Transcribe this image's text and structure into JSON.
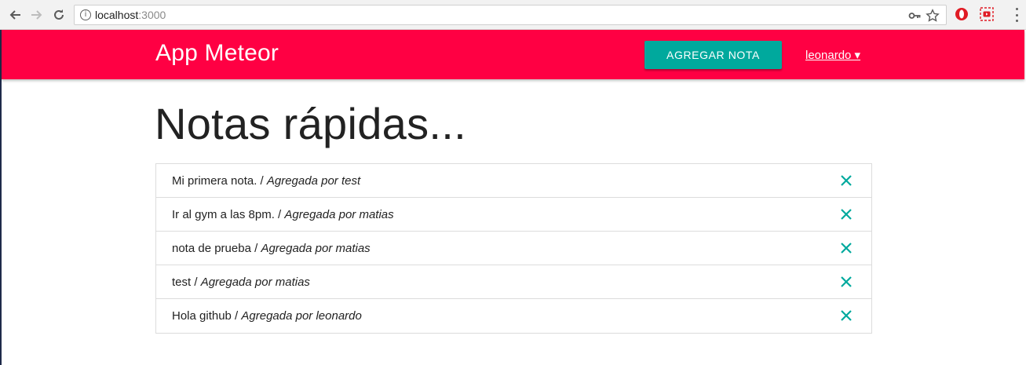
{
  "browser": {
    "address_host": "localhost",
    "address_port": ":3000"
  },
  "header": {
    "app_title": "App Meteor",
    "add_note_label": "AGREGAR NOTA",
    "user_label": "leonardo ▾",
    "accent_color": "#ff0043",
    "button_color": "#00a99d"
  },
  "main": {
    "title": "Notas rápidas...",
    "notes": [
      {
        "text": "Mi primera nota. / ",
        "author": "Agregada por test"
      },
      {
        "text": "Ir al gym a las 8pm. / ",
        "author": "Agregada por matias"
      },
      {
        "text": "nota de prueba / ",
        "author": "Agregada por matias"
      },
      {
        "text": "test / ",
        "author": "Agregada por matias"
      },
      {
        "text": "Hola github / ",
        "author": "Agregada por leonardo"
      }
    ],
    "delete_icon": "close-icon"
  }
}
